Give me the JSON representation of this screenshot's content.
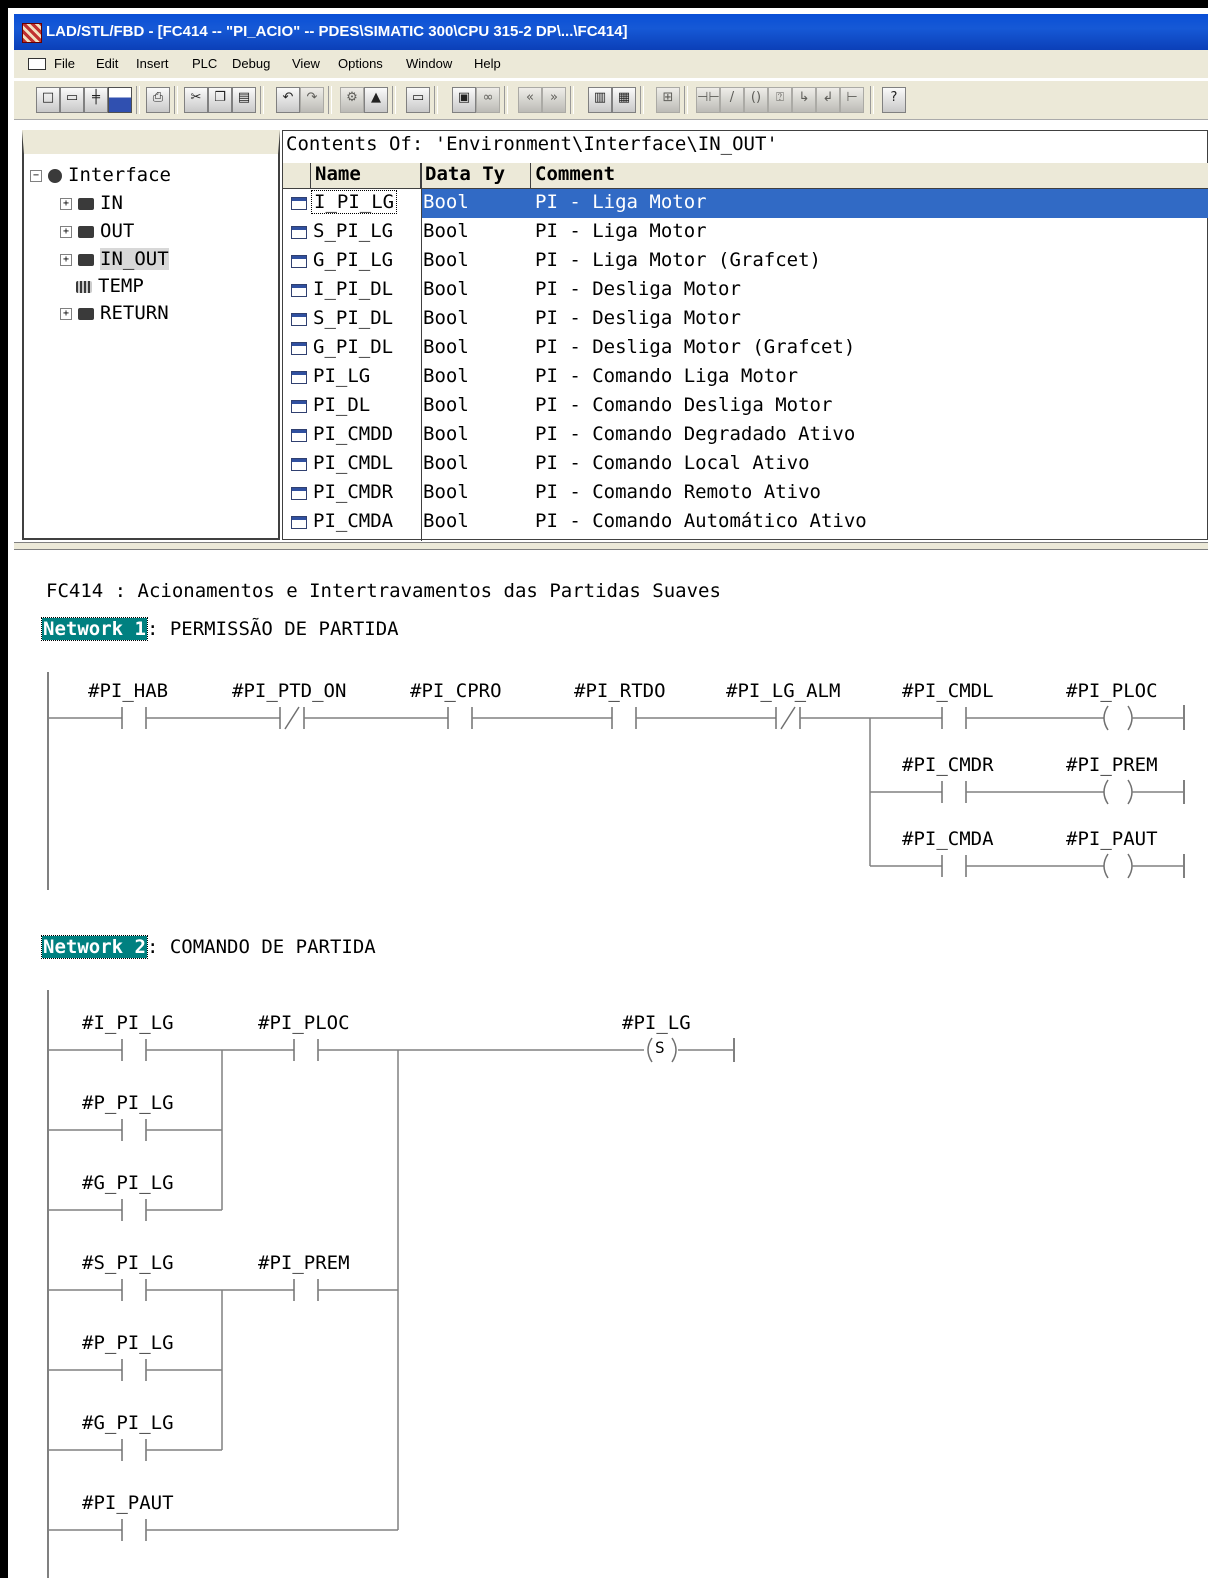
{
  "window": {
    "title": "LAD/STL/FBD  - [FC414 -- \"PI_ACIO\" -- PDES\\SIMATIC 300\\CPU 315-2 DP\\...\\FC414]"
  },
  "menu": [
    "File",
    "Edit",
    "Insert",
    "PLC",
    "Debug",
    "View",
    "Options",
    "Window",
    "Help"
  ],
  "toolbar_icons": [
    "new-icon",
    "open-icon",
    "network-icon",
    "save-icon",
    "print-icon",
    "cut-icon",
    "copy-icon",
    "paste-icon",
    "undo-icon",
    "redo-icon",
    "compile-icon",
    "download-icon",
    "monitor-icon",
    "accessible-nodes-icon",
    "online-icon",
    "first-network-icon",
    "last-network-icon",
    "overview-icon",
    "details-icon",
    "grid-icon",
    "contact-icon",
    "nc-contact-icon",
    "coil-icon",
    "box-icon",
    "branch-open-icon",
    "branch-close-icon",
    "connection-icon",
    "help-icon"
  ],
  "tree": {
    "root": "Interface",
    "items": [
      {
        "label": "IN",
        "expander": "+",
        "selected": false
      },
      {
        "label": "OUT",
        "expander": "+",
        "selected": false
      },
      {
        "label": "IN_OUT",
        "expander": "+",
        "selected": true
      },
      {
        "label": "TEMP",
        "expander": "",
        "selected": false
      },
      {
        "label": "RETURN",
        "expander": "+",
        "selected": false
      }
    ]
  },
  "contents": {
    "heading": "Contents Of: 'Environment\\Interface\\IN_OUT'",
    "columns": [
      "Name",
      "Data Ty",
      "Comment"
    ],
    "rows": [
      {
        "name": "I_PI_LG",
        "type": "Bool",
        "comment": "PI - Liga Motor",
        "selected": true
      },
      {
        "name": "S_PI_LG",
        "type": "Bool",
        "comment": "PI - Liga Motor"
      },
      {
        "name": "G_PI_LG",
        "type": "Bool",
        "comment": "PI - Liga Motor (Grafcet)"
      },
      {
        "name": "I_PI_DL",
        "type": "Bool",
        "comment": "PI - Desliga Motor"
      },
      {
        "name": "S_PI_DL",
        "type": "Bool",
        "comment": "PI - Desliga Motor"
      },
      {
        "name": "G_PI_DL",
        "type": "Bool",
        "comment": "PI - Desliga Motor (Grafcet)"
      },
      {
        "name": "PI_LG",
        "type": "Bool",
        "comment": "PI - Comando Liga Motor"
      },
      {
        "name": "PI_DL",
        "type": "Bool",
        "comment": "PI - Comando Desliga Motor"
      },
      {
        "name": "PI_CMDD",
        "type": "Bool",
        "comment": "PI - Comando Degradado Ativo"
      },
      {
        "name": "PI_CMDL",
        "type": "Bool",
        "comment": "PI - Comando Local Ativo"
      },
      {
        "name": "PI_CMDR",
        "type": "Bool",
        "comment": "PI - Comando Remoto Ativo"
      },
      {
        "name": "PI_CMDA",
        "type": "Bool",
        "comment": "PI - Comando Automático Ativo"
      }
    ]
  },
  "block": {
    "header": "FC414 : Acionamentos e Intertravamentos das Partidas Suaves",
    "networks": [
      {
        "tag": "Network 1",
        "title": ": PERMISSÃO DE PARTIDA",
        "contacts": [
          "#PI_HAB",
          "#PI_PTD_ON",
          "#PI_CPRO",
          "#PI_RTDO",
          "#PI_LG_ALM",
          "#PI_CMDL",
          "#PI_CMDR",
          "#PI_CMDA"
        ],
        "coils": [
          "#PI_PLOC",
          "#PI_PREM",
          "#PI_PAUT"
        ]
      },
      {
        "tag": "Network 2",
        "title": ": COMANDO DE PARTIDA",
        "contacts": [
          "#I_PI_LG",
          "#PI_PLOC",
          "#P_PI_LG",
          "#G_PI_LG",
          "#S_PI_LG",
          "#PI_PREM",
          "#P_PI_LG",
          "#G_PI_LG",
          "#PI_PAUT"
        ],
        "coil": "#PI_LG",
        "coil_type": "S"
      }
    ]
  }
}
